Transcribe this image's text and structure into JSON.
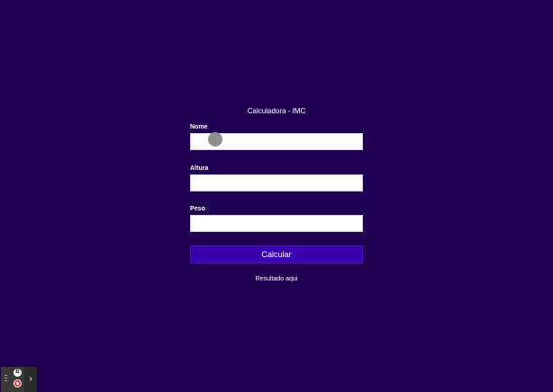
{
  "form": {
    "title": "Calculadora - IMC",
    "fields": [
      {
        "label": "Nome",
        "value": "",
        "placeholder": ""
      },
      {
        "label": "Altura",
        "value": "",
        "placeholder": ""
      },
      {
        "label": "Peso",
        "value": "",
        "placeholder": ""
      }
    ],
    "button_label": "Calcular",
    "result_text": "Resultado aqui"
  },
  "recorder_widget": {
    "badge_text": "B",
    "icons": [
      "drag-handle-icon",
      "badge-icon",
      "stop-record-icon",
      "chevron-right-icon"
    ],
    "expand_glyph": "›"
  },
  "colors": {
    "background": "#1f0051",
    "button": "#3a00ae",
    "text": "#ffffff",
    "input": "#ffffff"
  }
}
